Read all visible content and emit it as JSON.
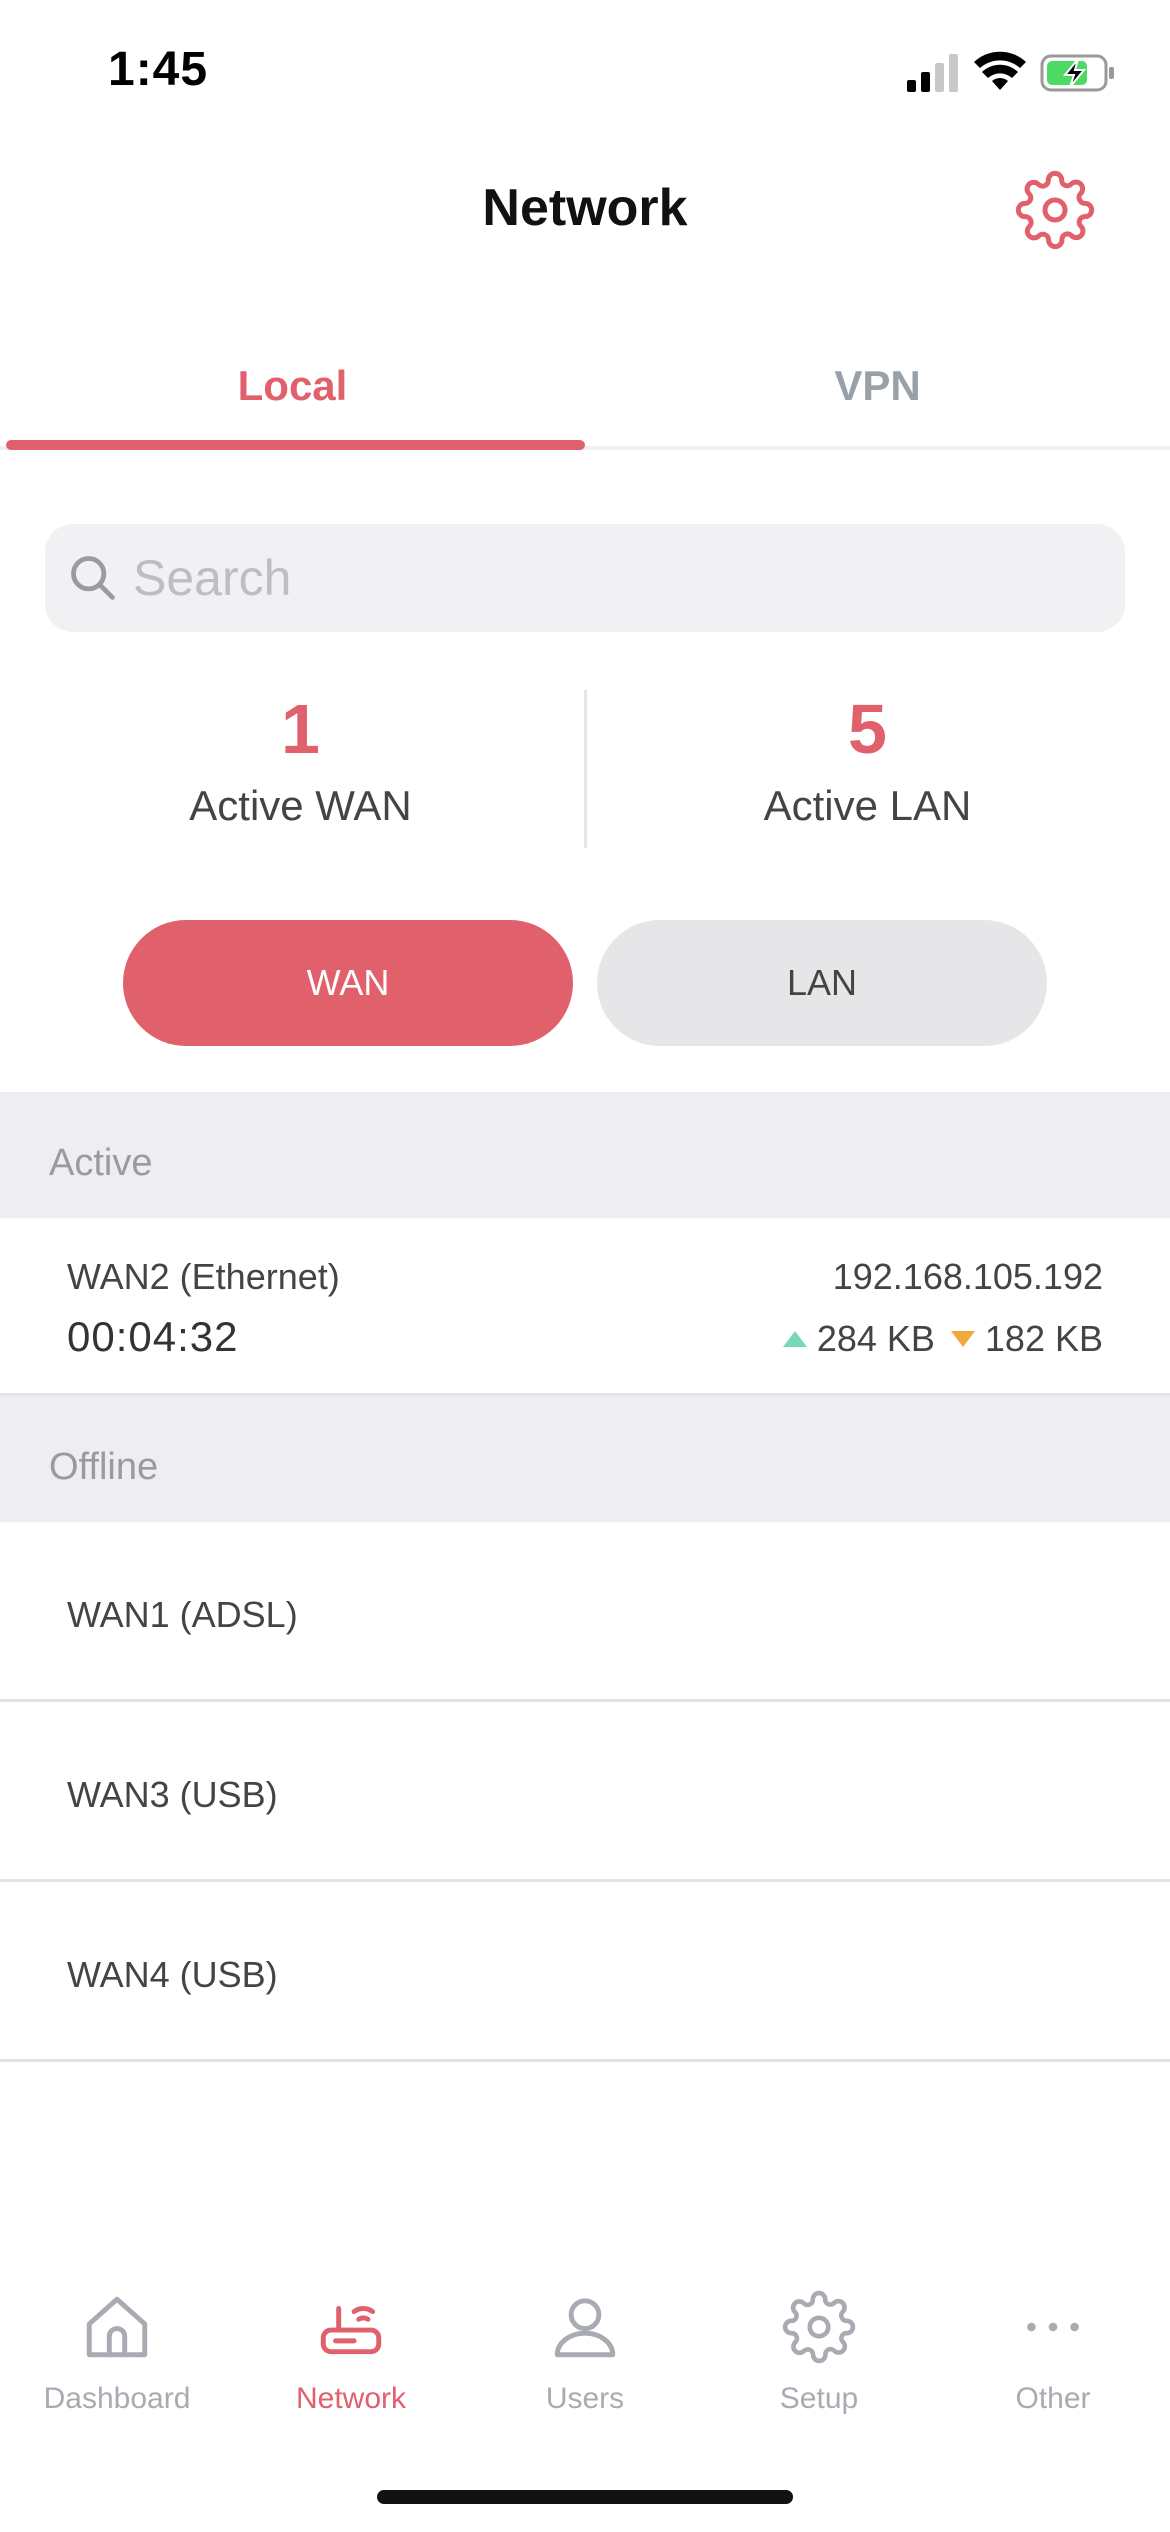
{
  "status_bar": {
    "time": "1:45",
    "icons": [
      "cellular-signal-icon",
      "wifi-icon",
      "battery-charging-icon"
    ]
  },
  "nav": {
    "title": "Network",
    "settings_icon": "gear-icon"
  },
  "tabs": [
    {
      "label": "Local",
      "active": true
    },
    {
      "label": "VPN",
      "active": false
    }
  ],
  "search": {
    "placeholder": "Search",
    "value": ""
  },
  "stats": {
    "wan": {
      "count": "1",
      "label": "Active WAN"
    },
    "lan": {
      "count": "5",
      "label": "Active LAN"
    }
  },
  "toggle": {
    "wan_label": "WAN",
    "lan_label": "LAN",
    "selected": "WAN"
  },
  "sections": {
    "active": {
      "title": "Active",
      "items": [
        {
          "name": "WAN2 (Ethernet)",
          "uptime": "00:04:32",
          "ip": "192.168.105.192",
          "upload": "284 KB",
          "download": "182 KB"
        }
      ]
    },
    "offline": {
      "title": "Offline",
      "items": [
        {
          "name": "WAN1 (ADSL)"
        },
        {
          "name": "WAN3 (USB)"
        },
        {
          "name": "WAN4 (USB)"
        }
      ]
    }
  },
  "tabbar": [
    {
      "label": "Dashboard",
      "icon": "home-icon",
      "active": false
    },
    {
      "label": "Network",
      "icon": "router-icon",
      "active": true
    },
    {
      "label": "Users",
      "icon": "user-icon",
      "active": false
    },
    {
      "label": "Setup",
      "icon": "gear-icon",
      "active": false
    },
    {
      "label": "Other",
      "icon": "more-dots-icon",
      "active": false
    }
  ],
  "colors": {
    "accent": "#e0606c",
    "inactive": "#a8acb2",
    "upload": "#7ad6b8",
    "download": "#f0a93c",
    "section_bg": "#eeeef2"
  }
}
